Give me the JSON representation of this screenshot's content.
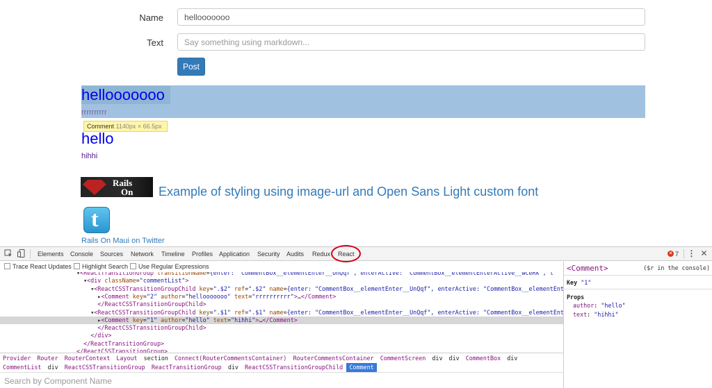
{
  "form": {
    "name_label": "Name",
    "name_value": "hellooooooo",
    "text_label": "Text",
    "text_placeholder": "Say something using markdown...",
    "post_button": "Post"
  },
  "comments": [
    {
      "author": "hellooooooo",
      "text": "rrrrrrrrrr"
    },
    {
      "author": "hello",
      "text": "hihhi"
    }
  ],
  "tooltip": {
    "name": "Comment",
    "dims": "1140px × 66.5px"
  },
  "rails_logo": {
    "line1": "Rails",
    "line2": "On Maui"
  },
  "styling_text": "Example of styling using image-url and Open Sans Light custom font",
  "twitter_logo_letter": "t",
  "twitter_link": "Rails On Maui on Twitter",
  "devtools": {
    "tabs": [
      "Elements",
      "Console",
      "Sources",
      "Network",
      "Timeline",
      "Profiles",
      "Application",
      "Security",
      "Audits",
      "Redux",
      "React"
    ],
    "error_count": "7",
    "options": [
      "Trace React Updates",
      "Highlight Search",
      "Use Regular Expressions"
    ],
    "tree": [
      "  ▾<ReactTransitionGroup transitionName={enter: \"CommentBox__elementEnter__UnQqf\", enterActive: \"CommentBox__elementEnterActive__wCeRk\", l",
      "    ▾<div className=\"commentList\">",
      "      ▾<ReactCSSTransitionGroupChild key=\".$2\" ref=\".$2\" name={enter: \"CommentBox__elementEnter__UnQqf\", enterActive: \"CommentBox__elementEnt",
      "        ▸<Comment key=\"2\" author=\"hellooooooo\" text=\"rrrrrrrrrr\">…</Comment>",
      "        </ReactCSSTransitionGroupChild>",
      "      ▾<ReactCSSTransitionGroupChild key=\".$1\" ref=\".$1\" name={enter: \"CommentBox__elementEnter__UnQqf\", enterActive: \"CommentBox__elementEnt",
      "        ▸<Comment key=\"1\" author=\"hello\" text=\"hihhi\">…</Comment>",
      "        </ReactCSSTransitionGroupChild>",
      "      </div>",
      "    </ReactTransitionGroup>",
      "  </ReactCSSTransitionGroup>"
    ],
    "selected_tree_index": 6,
    "path_row1": [
      "Provider",
      "Router",
      "RouterContext",
      "Layout",
      "section",
      "Connect(RouterCommentsContainer)",
      "RouterCommentsContainer",
      "CommentScreen",
      "div",
      "div",
      "CommentBox",
      "div"
    ],
    "path_row2": [
      "CommentList",
      "div",
      "ReactCSSTransitionGroup",
      "ReactTransitionGroup",
      "div",
      "ReactCSSTransitionGroupChild",
      "Comment"
    ],
    "search_placeholder": "Search by Component Name",
    "side": {
      "component": "<Comment>",
      "hint": "($r in the console)",
      "key_label": "Key",
      "key_value": "\"1\"",
      "props_label": "Props",
      "props": [
        {
          "k": "author",
          "v": "\"hello\""
        },
        {
          "k": "text",
          "v": "\"hihhi\""
        }
      ]
    }
  }
}
